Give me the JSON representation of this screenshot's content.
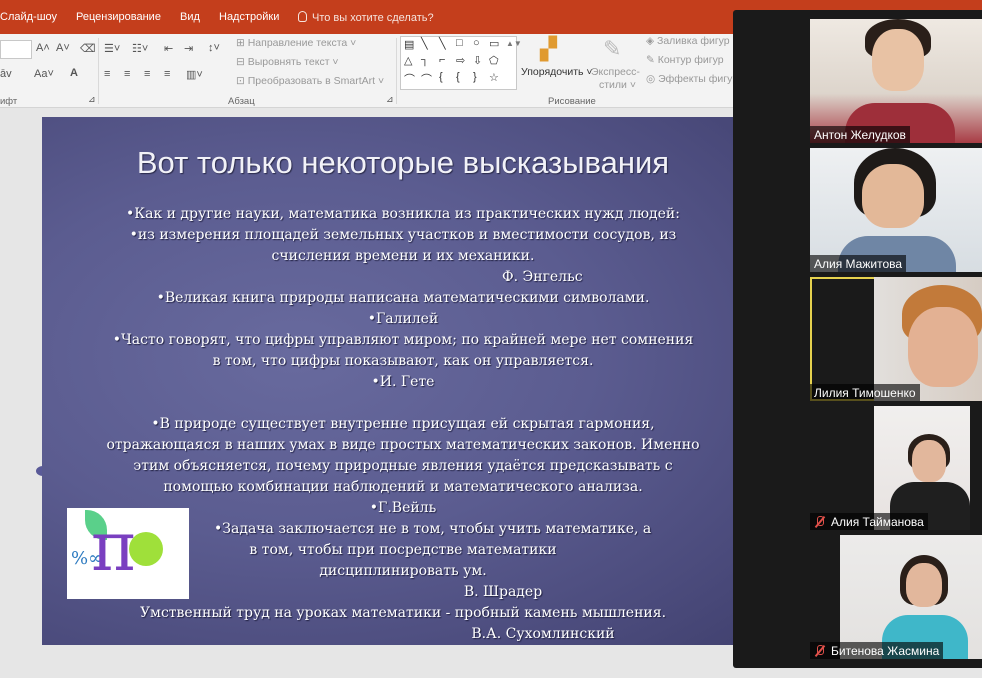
{
  "ribbon": {
    "tabs": [
      "Слайд-шоу",
      "Рецензирование",
      "Вид",
      "Надстройки"
    ],
    "tell_me": "Что вы хотите сделать?",
    "font_group_label": "ифт",
    "paragraph": {
      "text_direction": "Направление текста",
      "align_text": "Выровнять текст",
      "smartart": "Преобразовать в SmartArt",
      "label": "Абзац"
    },
    "drawing": {
      "arrange": "Упорядочить",
      "quick_styles_1": "Экспресс-",
      "quick_styles_2": "стили",
      "shape_fill": "Заливка фигур",
      "shape_outline": "Контур фигур",
      "shape_effects": "Эффекты фигур",
      "label": "Рисование"
    }
  },
  "slide": {
    "title": "Вот только некоторые высказывания",
    "lines": [
      "•Как и другие науки, математика возникла из практических нужд людей:",
      "•из измерения площадей земельных участков и вместимости сосудов, из",
      "счисления времени и их механики.",
      "Ф. Энгельс",
      "•Великая книга природы написана математическими символами.",
      "•Галилей",
      "•Часто говорят, что цифры управляют миром; по крайней мере нет сомнения",
      "в том, что цифры показывают, как он управляется.",
      "•И. Гете",
      "•В природе существует внутренне присущая ей скрытая гармония,",
      "отражающаяся в наших умах в виде простых математических законов. Именно",
      "этим объясняется, почему природные явления удаётся предсказывать с",
      "помощью комбинации наблюдений и математического анализа.",
      "•Г.Вейль",
      "•Задача заключается не в том, чтобы учить математике, а",
      "в том, чтобы при посредстве математики",
      "дисциплинировать ум.",
      "В. Шрадер",
      "Умственный труд на уроках математики - пробный камень мышления.",
      "В.А. Сухомлинский"
    ]
  },
  "participants": [
    {
      "name": "Антон Желудков",
      "muted": false
    },
    {
      "name": "Алия Мажитова",
      "muted": false
    },
    {
      "name": "Лилия Тимошенко",
      "muted": false,
      "active_speaker": true
    },
    {
      "name": "Алия Тайманова",
      "muted": true
    },
    {
      "name": "Битенова Жасмина",
      "muted": true
    }
  ]
}
